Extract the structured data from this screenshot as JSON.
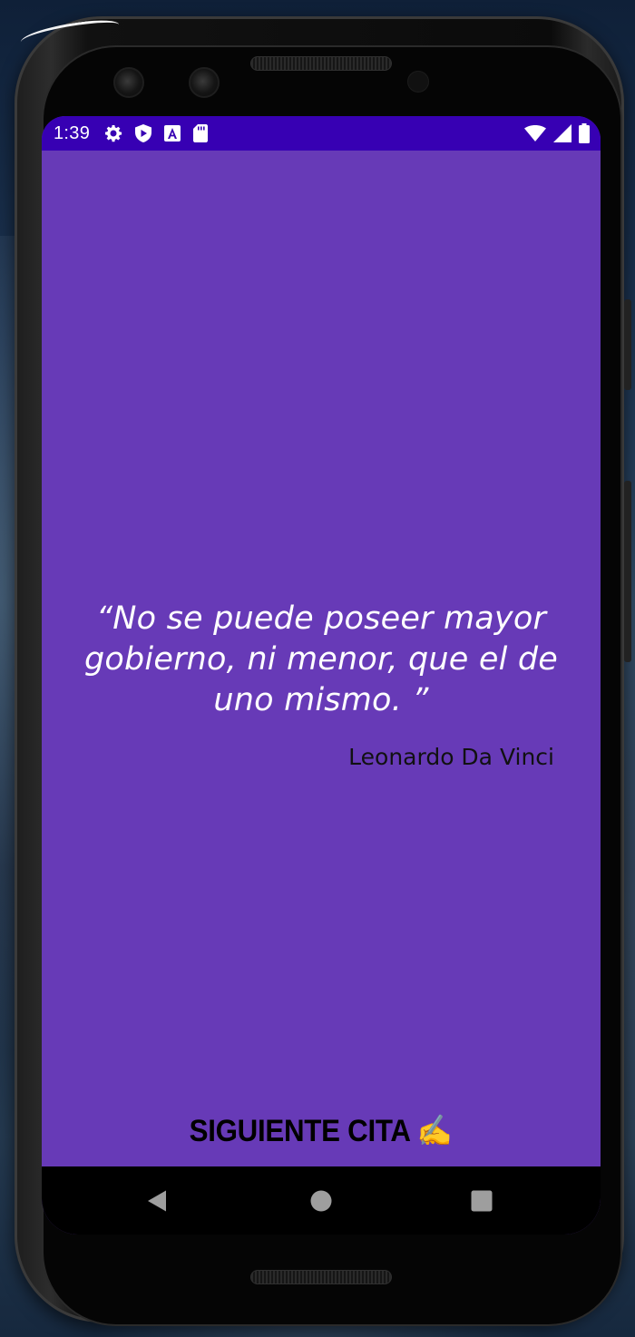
{
  "status_bar": {
    "time": "1:39",
    "left_icons": [
      "gear-icon",
      "shield-play-icon",
      "font-a-icon",
      "sd-card-icon"
    ],
    "right_icons": [
      "wifi-icon",
      "signal-icon",
      "battery-icon"
    ],
    "background": "#3700b3"
  },
  "quote": {
    "text": "“No se puede poseer mayor gobierno, ni menor, que el de uno mismo. ”",
    "author": "Leonardo Da Vinci"
  },
  "actions": {
    "next_label": "SIGUIENTE CITA ✍"
  },
  "nav_bar": {
    "buttons": [
      "back-icon",
      "home-icon",
      "recents-icon"
    ]
  },
  "colors": {
    "screen_background": "#673ab7",
    "quote_color": "#ffffff",
    "author_color": "#111111",
    "button_text_color": "#000000"
  }
}
